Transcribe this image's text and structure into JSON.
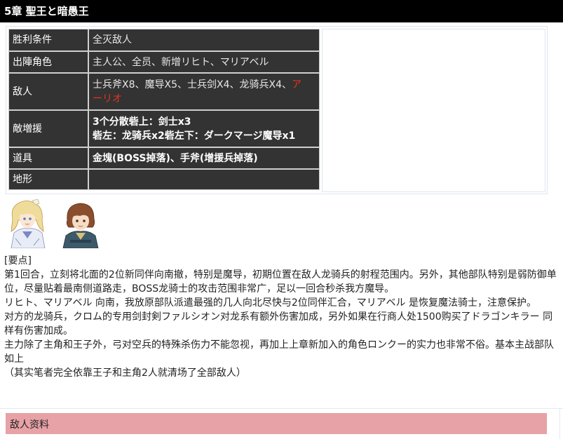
{
  "title": "5章 聖王と暗愚王",
  "info": {
    "victory": {
      "label": "胜利条件",
      "value": "全灭敌人"
    },
    "units": {
      "label": "出陣角色",
      "value": "主人公、全员、新增リヒト、マリアベル"
    },
    "enemies": {
      "label": "敌人",
      "value_line1": "士兵斧X8、魔导X5、士兵剑X4、龙骑兵X4、",
      "value_highlight1": "ア",
      "value_highlight2": "ーリオ"
    },
    "reinforcements": {
      "label": "敵増援",
      "line1": "3个分散砦上：剑士x3",
      "line2": "砦左：龙骑兵x2砦左下：ダークマージ魔导x1"
    },
    "items": {
      "label": "道具",
      "value": "金塊(BOSS掉落)、手斧(增援兵掉落)"
    },
    "terrain": {
      "label": "地形",
      "value": ""
    }
  },
  "portraits": [
    {
      "icon": "blonde-princess-portrait"
    },
    {
      "icon": "brown-haired-boy-portrait"
    }
  ],
  "notes": {
    "heading": "[要点]",
    "p1": "第1回合，立刻将北面的2位新同伴向南撤，特别是魔导，初期位置在敌人龙骑兵的射程范围内。另外，其他部队特别是弱防御单位，尽量贴着最南侧道路走，BOSS龙骑士的攻击范围非常广，足以一回合秒杀我方魔导。",
    "p2": "リヒト、マリアベル 向南，我放原部队派遣最强的几人向北尽快与2位同伴汇合，マリアベル 是恢复魔法骑士，注意保护。",
    "p3": "对方的龙骑兵，クロム的专用剑封剣ファルシオン对龙系有额外伤害加成，另外如果在行商人处1500购买了ドラゴンキラー 同样有伤害加成。",
    "p4": "主力除了主角和王子外，弓对空兵的特殊杀伤力不能忽视，再加上上章新加入的角色ロンクー的实力也非常不俗。基本主战部队如上",
    "p5": "（其实笔者完全依靠王子和主角2人就清场了全部敌人）"
  },
  "enemy_section": {
    "label": "敌人资料"
  }
}
